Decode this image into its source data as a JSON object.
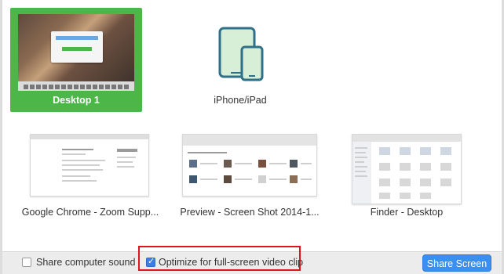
{
  "tiles": {
    "desktop": {
      "label": "Desktop 1",
      "selected": true
    },
    "ipad": {
      "label": "iPhone/iPad"
    },
    "chrome": {
      "label": "Google Chrome - Zoom Supp..."
    },
    "preview": {
      "label": "Preview - Screen Shot 2014-1..."
    },
    "finder": {
      "label": "Finder - Desktop"
    }
  },
  "bottom": {
    "share_sound_label": "Share computer sound",
    "share_sound_checked": false,
    "optimize_label": "Optimize for full-screen video clip",
    "optimize_checked": true,
    "share_button_label": "Share Screen"
  },
  "colors": {
    "selected_tile": "#4cb748",
    "highlight_box": "#e0141e",
    "primary_button": "#3a8ff0",
    "ipad_device_fill": "#d7eed7",
    "ipad_device_stroke": "#2f6f88"
  }
}
